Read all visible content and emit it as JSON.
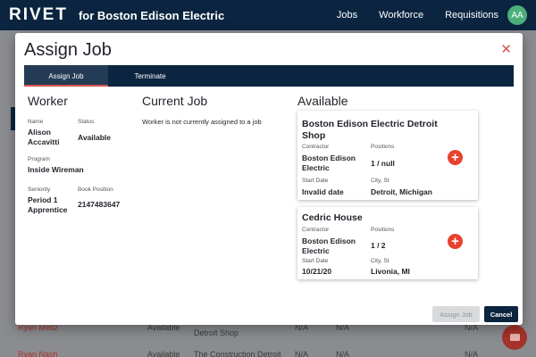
{
  "app": {
    "brand": "RIVET",
    "subtitle": "for Boston Edison Electric",
    "nav": [
      "Jobs",
      "Workforce",
      "Requisitions"
    ],
    "avatar": "AA"
  },
  "background": {
    "rows": [
      {
        "name": "Ryan Meitz",
        "status": "Available",
        "job": "Detroit Shop",
        "c1": "N/A",
        "c2": "N/A",
        "c3": "N/A"
      },
      {
        "name": "Ryan Nash",
        "status": "Available",
        "job": "The Construction Detroit",
        "c1": "N/A",
        "c2": "N/A",
        "c3": "N/A"
      }
    ]
  },
  "modal": {
    "title": "Assign Job",
    "close_icon": "close-icon",
    "tabs": [
      {
        "label": "Assign Job",
        "active": true
      },
      {
        "label": "Terminate",
        "active": false
      }
    ],
    "worker": {
      "heading": "Worker",
      "name_label": "Name",
      "name": "Alison Accavitti",
      "status_label": "Status",
      "status": "Available",
      "program_label": "Program",
      "program": "Inside Wireman",
      "seniority_label": "Seniority",
      "seniority": "Period 1 Apprentice",
      "book_label": "Book Position",
      "book": "2147483647"
    },
    "current_job": {
      "heading": "Current Job",
      "message": "Worker is not currently assigned to a job"
    },
    "available": {
      "heading": "Available",
      "cards": [
        {
          "title": "Boston Edison Electric Detroit Shop",
          "contractor_label": "Contractor",
          "contractor": "Boston Edison Electric",
          "positions_label": "Positions",
          "positions": "1 / null",
          "start_label": "Start Date",
          "start": "Invalid date",
          "city_label": "City, St",
          "city": "Detroit, Michigan"
        },
        {
          "title": "Cedric House",
          "contractor_label": "Contractor",
          "contractor": "Boston Edison Electric",
          "positions_label": "Positions",
          "positions": "1 / 2",
          "start_label": "Start Date",
          "start": "10/21/20",
          "city_label": "City, St",
          "city": "Livonia, MI"
        }
      ]
    },
    "buttons": {
      "assign": "Assign Job",
      "cancel": "Cancel"
    }
  },
  "colors": {
    "navy": "#0b2540",
    "accent_red": "#d9534f",
    "plus_red": "#e8412e",
    "avatar_green": "#4caf7a"
  }
}
